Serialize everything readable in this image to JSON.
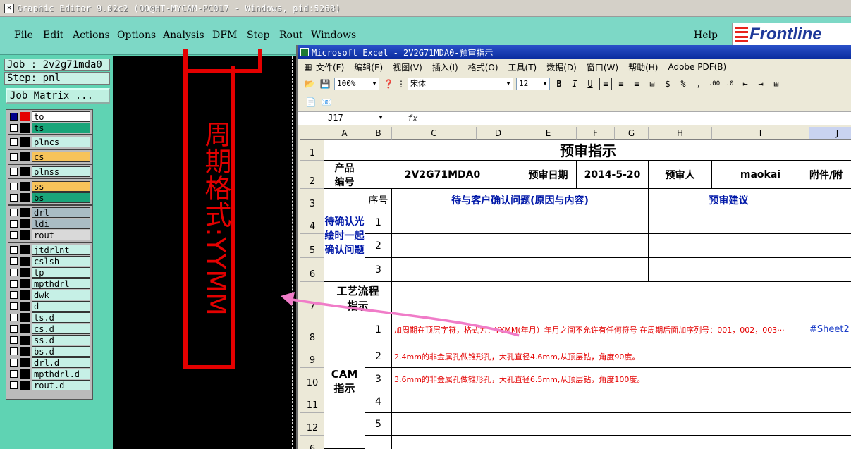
{
  "ge": {
    "title": "Graphic Editor 9.02c2 (OO@HT-MYCAM-PC017 - Windows, pid:5268)",
    "menu": [
      "File",
      "Edit",
      "Actions",
      "Options",
      "Analysis",
      "DFM",
      "Step",
      "Rout",
      "Windows",
      "Help"
    ],
    "logo": "Frontline",
    "job": "Job : 2v2g71mda0",
    "step": "Step: pnl",
    "matrix_btn": "Job Matrix ...",
    "canvas_text": "周期格式:YYMM"
  },
  "layers": [
    {
      "name": "to",
      "color": "#ffffff",
      "sw": "#e40000",
      "checked": true
    },
    {
      "name": "ts",
      "color": "#1aa57a",
      "checked": false
    },
    {
      "name": "plncs",
      "color": "#c6f0e6",
      "checked": false
    },
    {
      "name": "cs",
      "color": "#f7c35a",
      "checked": false
    },
    {
      "name": "plnss",
      "color": "#c6f0e6",
      "checked": false
    },
    {
      "name": "ss",
      "color": "#f7c35a",
      "checked": false
    },
    {
      "name": "bs",
      "color": "#1aa57a",
      "checked": false
    },
    {
      "name": "drl",
      "color": "#a9bcc4",
      "checked": false
    },
    {
      "name": "ldi",
      "color": "#a9bcc4",
      "checked": false
    },
    {
      "name": "rout",
      "color": "#d9d9d9",
      "checked": false
    },
    {
      "name": "jtdrlnt",
      "color": "#c6f0e6",
      "checked": false
    },
    {
      "name": "cslsh",
      "color": "#c6f0e6",
      "checked": false
    },
    {
      "name": "tp",
      "color": "#c6f0e6",
      "checked": false
    },
    {
      "name": "mpthdrl",
      "color": "#c6f0e6",
      "checked": false
    },
    {
      "name": "dwk",
      "color": "#c6f0e6",
      "checked": false
    },
    {
      "name": "d",
      "color": "#c6f0e6",
      "checked": false
    },
    {
      "name": "ts.d",
      "color": "#c6f0e6",
      "checked": false
    },
    {
      "name": "cs.d",
      "color": "#c6f0e6",
      "checked": false
    },
    {
      "name": "ss.d",
      "color": "#c6f0e6",
      "checked": false
    },
    {
      "name": "bs.d",
      "color": "#c6f0e6",
      "checked": false
    },
    {
      "name": "drl.d",
      "color": "#c6f0e6",
      "checked": false
    },
    {
      "name": "mpthdrl.d",
      "color": "#c6f0e6",
      "checked": false
    },
    {
      "name": "rout.d",
      "color": "#c6f0e6",
      "checked": false
    }
  ],
  "xl": {
    "title": "Microsoft Excel - 2V2G71MDA0-预审指示",
    "menu": [
      "文件(F)",
      "编辑(E)",
      "视图(V)",
      "插入(I)",
      "格式(O)",
      "工具(T)",
      "数据(D)",
      "窗口(W)",
      "帮助(H)",
      "Adobe PDF(B)"
    ],
    "zoom": "100%",
    "font": "宋体",
    "size": "12",
    "cellref": "J17",
    "fx": "fx",
    "cols": [
      "A",
      "B",
      "C",
      "D",
      "E",
      "F",
      "G",
      "H",
      "I",
      "J"
    ],
    "rows": [
      "1",
      "2",
      "3",
      "4",
      "5",
      "6",
      "7",
      "8",
      "9",
      "10",
      "11",
      "12",
      "6"
    ],
    "t_title": "预审指示",
    "prod_label": "产品\n编号",
    "prod_val": "2V2G71MDA0",
    "date_label": "预审日期",
    "date_val": "2014-5-20",
    "rev_label": "预审人",
    "rev_val": "maokai",
    "att_label": "附件/附",
    "seq": "序号",
    "q_hdr": "待与客户确认问题(原因与内容)",
    "adv_hdr": "预审建议",
    "pending": "待确认光绘时一起确认问题",
    "n1": "1",
    "n2": "2",
    "n3": "3",
    "n4": "4",
    "n5": "5",
    "flow": "工艺流程指示",
    "cam": "CAM\n指示",
    "r8": "加周期在顶层字符，格式为：YYMM(年月）年月之间不允许有任何符号 在周期后面加序列号：001，002，003···",
    "r9": "2.4mm的非金属孔做锥形孔，大孔直径4.6mm,从顶层钻，角度90度。",
    "r10": "3.6mm的非金属孔做锥形孔，大孔直径6.5mm,从顶层钻，角度100度。",
    "link": "#Sheet2"
  }
}
